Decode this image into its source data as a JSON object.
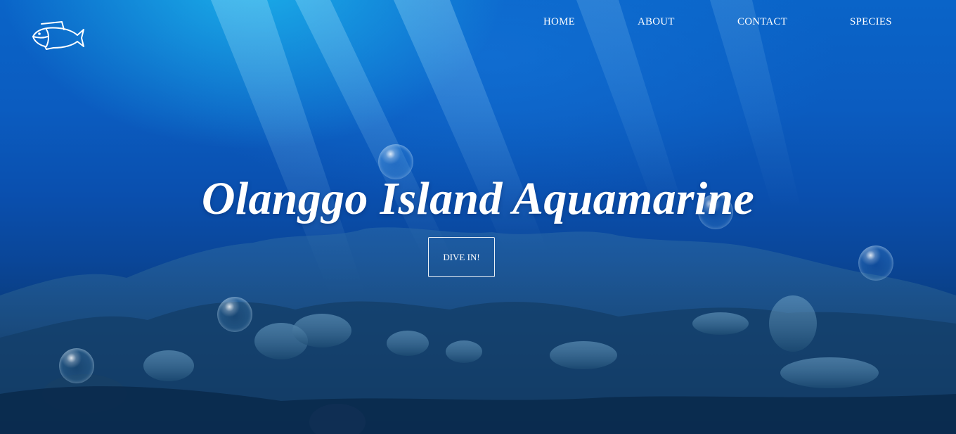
{
  "brand": {
    "logo_icon": "fish-outline-icon"
  },
  "nav": {
    "items": [
      {
        "label": "HOME"
      },
      {
        "label": "ABOUT"
      },
      {
        "label": "CONTACT"
      },
      {
        "label": "SPECIES"
      }
    ]
  },
  "hero": {
    "title": "Olanggo Island Aquamarine",
    "cta_label": "DIVE IN!",
    "background": "underwater-coral-reef",
    "decoration_icon": "bubble-icon"
  },
  "colors": {
    "text": "#ffffff",
    "water_top": "#0a64c8",
    "water_bottom": "#062748",
    "light_rays": "#1ebef0"
  }
}
